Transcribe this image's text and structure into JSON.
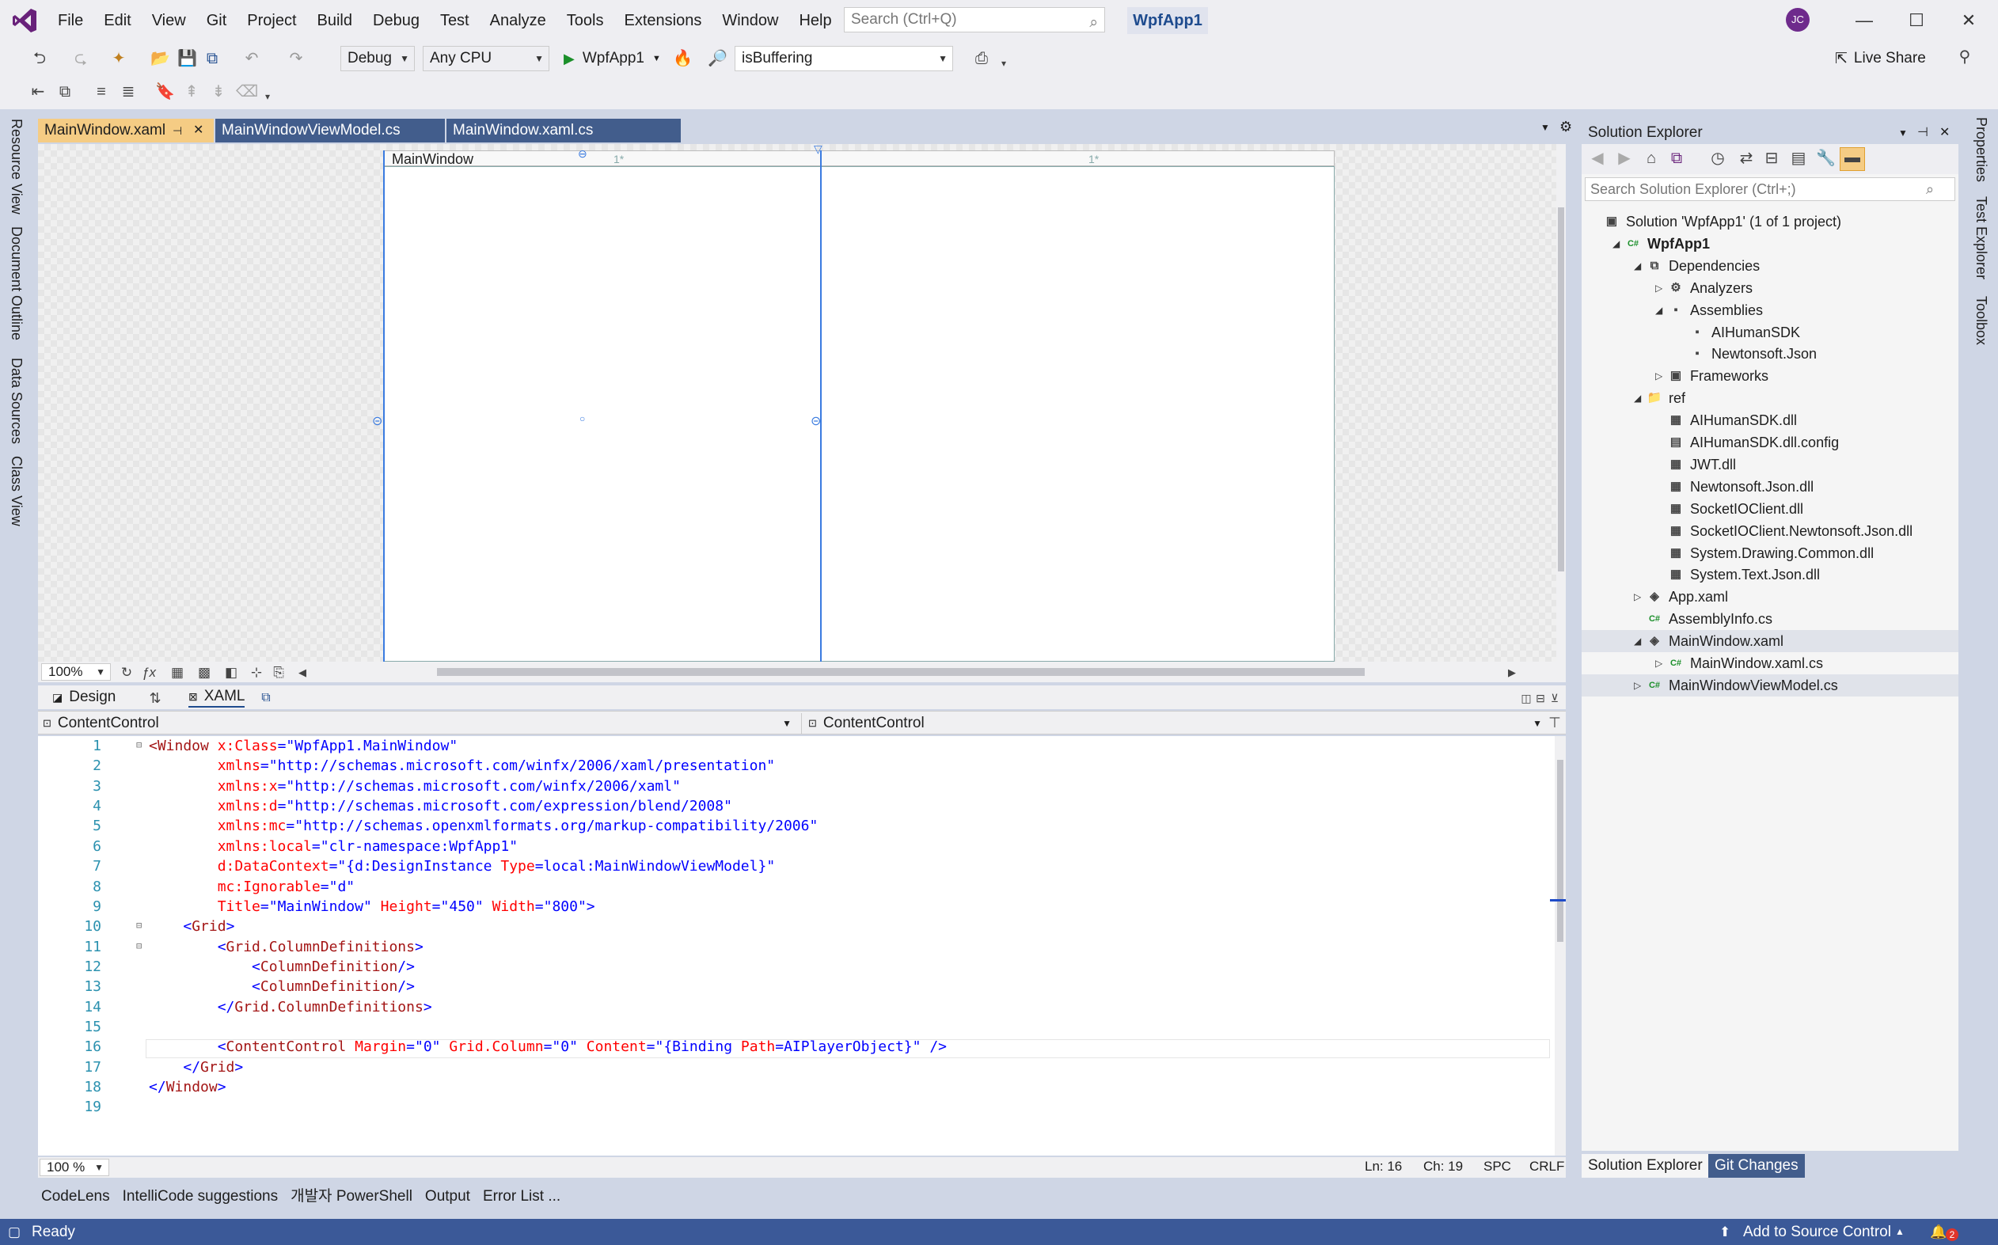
{
  "window": {
    "menu": [
      "File",
      "Edit",
      "View",
      "Git",
      "Project",
      "Build",
      "Debug",
      "Test",
      "Analyze",
      "Tools",
      "Extensions",
      "Window",
      "Help"
    ],
    "search_placeholder": "Search (Ctrl+Q)",
    "solution_name": "WpfApp1",
    "avatar_initials": "JC",
    "min": "—",
    "max": "☐",
    "close": "✕"
  },
  "toolbar": {
    "config": "Debug",
    "platform": "Any CPU",
    "run_target": "WpfApp1",
    "find_combo": "isBuffering",
    "live_share": "Live Share"
  },
  "left_tabs": [
    "Resource View",
    "Document Outline",
    "Data Sources",
    "Class View"
  ],
  "right_tabs": [
    "Properties",
    "Test Explorer",
    "Toolbox"
  ],
  "doc_tabs": [
    "MainWindow.xaml",
    "MainWindowViewModel.cs",
    "MainWindow.xaml.cs"
  ],
  "designer": {
    "window_title": "MainWindow",
    "col_marker_1": "1*",
    "col_marker_2": "1*",
    "zoom": "100%",
    "tab_design": "Design",
    "tab_xaml": "XAML",
    "combo_left": "ContentControl",
    "combo_right": "ContentControl"
  },
  "code": {
    "line_numbers": [
      "1",
      "2",
      "3",
      "4",
      "5",
      "6",
      "7",
      "8",
      "9",
      "10",
      "11",
      "12",
      "13",
      "14",
      "15",
      "16",
      "17",
      "18",
      "19"
    ],
    "lines": [
      [
        [
          "t",
          "<Window "
        ],
        [
          "a",
          "x:Class"
        ],
        [
          "p",
          "=\""
        ],
        [
          "v",
          "WpfApp1.MainWindow"
        ],
        [
          "p",
          "\""
        ]
      ],
      [
        [
          "s",
          "        "
        ],
        [
          "a",
          "xmlns"
        ],
        [
          "p",
          "=\""
        ],
        [
          "v",
          "http://schemas.microsoft.com/winfx/2006/xaml/presentation"
        ],
        [
          "p",
          "\""
        ]
      ],
      [
        [
          "s",
          "        "
        ],
        [
          "a",
          "xmlns:x"
        ],
        [
          "p",
          "=\""
        ],
        [
          "v",
          "http://schemas.microsoft.com/winfx/2006/xaml"
        ],
        [
          "p",
          "\""
        ]
      ],
      [
        [
          "s",
          "        "
        ],
        [
          "a",
          "xmlns:d"
        ],
        [
          "p",
          "=\""
        ],
        [
          "v",
          "http://schemas.microsoft.com/expression/blend/2008"
        ],
        [
          "p",
          "\""
        ]
      ],
      [
        [
          "s",
          "        "
        ],
        [
          "a",
          "xmlns:mc"
        ],
        [
          "p",
          "=\""
        ],
        [
          "v",
          "http://schemas.openxmlformats.org/markup-compatibility/2006"
        ],
        [
          "p",
          "\""
        ]
      ],
      [
        [
          "s",
          "        "
        ],
        [
          "a",
          "xmlns:local"
        ],
        [
          "p",
          "=\""
        ],
        [
          "v",
          "clr-namespace:WpfApp1"
        ],
        [
          "p",
          "\""
        ]
      ],
      [
        [
          "s",
          "        "
        ],
        [
          "a",
          "d:DataContext"
        ],
        [
          "p",
          "=\""
        ],
        [
          "v",
          "{d:DesignInstance "
        ],
        [
          "a",
          "Type"
        ],
        [
          "v",
          "=local:MainWindowViewModel}"
        ],
        [
          "p",
          "\""
        ]
      ],
      [
        [
          "s",
          "        "
        ],
        [
          "a",
          "mc:Ignorable"
        ],
        [
          "p",
          "=\""
        ],
        [
          "v",
          "d"
        ],
        [
          "p",
          "\""
        ]
      ],
      [
        [
          "s",
          "        "
        ],
        [
          "a",
          "Title"
        ],
        [
          "p",
          "=\""
        ],
        [
          "v",
          "MainWindow"
        ],
        [
          "p",
          "\" "
        ],
        [
          "a",
          "Height"
        ],
        [
          "p",
          "=\""
        ],
        [
          "v",
          "450"
        ],
        [
          "p",
          "\" "
        ],
        [
          "a",
          "Width"
        ],
        [
          "p",
          "=\""
        ],
        [
          "v",
          "800"
        ],
        [
          "p",
          "\">"
        ]
      ],
      [
        [
          "s",
          "    "
        ],
        [
          "p",
          "<"
        ],
        [
          "t",
          "Grid"
        ],
        [
          "p",
          ">"
        ]
      ],
      [
        [
          "s",
          "        "
        ],
        [
          "p",
          "<"
        ],
        [
          "t",
          "Grid.ColumnDefinitions"
        ],
        [
          "p",
          ">"
        ]
      ],
      [
        [
          "s",
          "            "
        ],
        [
          "p",
          "<"
        ],
        [
          "t",
          "ColumnDefinition"
        ],
        [
          "p",
          "/>"
        ]
      ],
      [
        [
          "s",
          "            "
        ],
        [
          "p",
          "<"
        ],
        [
          "t",
          "ColumnDefinition"
        ],
        [
          "p",
          "/>"
        ]
      ],
      [
        [
          "s",
          "        "
        ],
        [
          "p",
          "</"
        ],
        [
          "t",
          "Grid.ColumnDefinitions"
        ],
        [
          "p",
          ">"
        ]
      ],
      [
        [
          "s",
          ""
        ]
      ],
      [
        [
          "s",
          "        "
        ],
        [
          "p",
          "<"
        ],
        [
          "t",
          "ContentControl"
        ],
        [
          "s",
          " "
        ],
        [
          "a",
          "Margin"
        ],
        [
          "p",
          "=\""
        ],
        [
          "v",
          "0"
        ],
        [
          "p",
          "\" "
        ],
        [
          "a",
          "Grid.Column"
        ],
        [
          "p",
          "=\""
        ],
        [
          "v",
          "0"
        ],
        [
          "p",
          "\" "
        ],
        [
          "a",
          "Content"
        ],
        [
          "p",
          "=\""
        ],
        [
          "v",
          "{Binding "
        ],
        [
          "a",
          "Path"
        ],
        [
          "v",
          "=AIPlayerObject}"
        ],
        [
          "p",
          "\" />"
        ]
      ],
      [
        [
          "s",
          "    "
        ],
        [
          "p",
          "</"
        ],
        [
          "t",
          "Grid"
        ],
        [
          "p",
          ">"
        ]
      ],
      [
        [
          "p",
          "</"
        ],
        [
          "t",
          "Window"
        ],
        [
          "p",
          ">"
        ]
      ],
      [
        [
          "s",
          ""
        ]
      ]
    ]
  },
  "editor_status": {
    "zoom": "100 %",
    "line": "Ln: 16",
    "col": "Ch: 19",
    "spc": "SPC",
    "crlf": "CRLF"
  },
  "bottom_tabs": [
    "CodeLens",
    "IntelliCode suggestions",
    "개발자 PowerShell",
    "Output",
    "Error List ..."
  ],
  "status": {
    "ready": "Ready",
    "source_control": "Add to Source Control",
    "notifications": "2"
  },
  "solution_explorer": {
    "title": "Solution Explorer",
    "search_placeholder": "Search Solution Explorer (Ctrl+;)",
    "tree": [
      {
        "label": "Solution 'WpfApp1' (1 of 1 project)",
        "depth": 0,
        "exp": "",
        "icon": "▣",
        "bold": false
      },
      {
        "label": "WpfApp1",
        "depth": 1,
        "exp": "◢",
        "icon": "C#",
        "bold": true
      },
      {
        "label": "Dependencies",
        "depth": 2,
        "exp": "◢",
        "icon": "⧉",
        "bold": false
      },
      {
        "label": "Analyzers",
        "depth": 3,
        "exp": "▷",
        "icon": "⚙",
        "bold": false
      },
      {
        "label": "Assemblies",
        "depth": 3,
        "exp": "◢",
        "icon": "▪",
        "bold": false
      },
      {
        "label": "AIHumanSDK",
        "depth": 4,
        "exp": "",
        "icon": "▪",
        "bold": false
      },
      {
        "label": "Newtonsoft.Json",
        "depth": 4,
        "exp": "",
        "icon": "▪",
        "bold": false
      },
      {
        "label": "Frameworks",
        "depth": 3,
        "exp": "▷",
        "icon": "▣",
        "bold": false
      },
      {
        "label": "ref",
        "depth": 2,
        "exp": "◢",
        "icon": "📁",
        "bold": false
      },
      {
        "label": "AIHumanSDK.dll",
        "depth": 3,
        "exp": "",
        "icon": "▦",
        "bold": false
      },
      {
        "label": "AIHumanSDK.dll.config",
        "depth": 3,
        "exp": "",
        "icon": "▤",
        "bold": false
      },
      {
        "label": "JWT.dll",
        "depth": 3,
        "exp": "",
        "icon": "▦",
        "bold": false
      },
      {
        "label": "Newtonsoft.Json.dll",
        "depth": 3,
        "exp": "",
        "icon": "▦",
        "bold": false
      },
      {
        "label": "SocketIOClient.dll",
        "depth": 3,
        "exp": "",
        "icon": "▦",
        "bold": false
      },
      {
        "label": "SocketIOClient.Newtonsoft.Json.dll",
        "depth": 3,
        "exp": "",
        "icon": "▦",
        "bold": false
      },
      {
        "label": "System.Drawing.Common.dll",
        "depth": 3,
        "exp": "",
        "icon": "▦",
        "bold": false
      },
      {
        "label": "System.Text.Json.dll",
        "depth": 3,
        "exp": "",
        "icon": "▦",
        "bold": false
      },
      {
        "label": "App.xaml",
        "depth": 2,
        "exp": "▷",
        "icon": "◈",
        "bold": false
      },
      {
        "label": "AssemblyInfo.cs",
        "depth": 2,
        "exp": "",
        "icon": "C#",
        "bold": false
      },
      {
        "label": "MainWindow.xaml",
        "depth": 2,
        "exp": "◢",
        "icon": "◈",
        "bold": false
      },
      {
        "label": "MainWindow.xaml.cs",
        "depth": 3,
        "exp": "▷",
        "icon": "C#",
        "bold": false
      },
      {
        "label": "MainWindowViewModel.cs",
        "depth": 2,
        "exp": "▷",
        "icon": "C#",
        "bold": false
      }
    ],
    "tab_solution": "Solution Explorer",
    "tab_git": "Git Changes"
  }
}
